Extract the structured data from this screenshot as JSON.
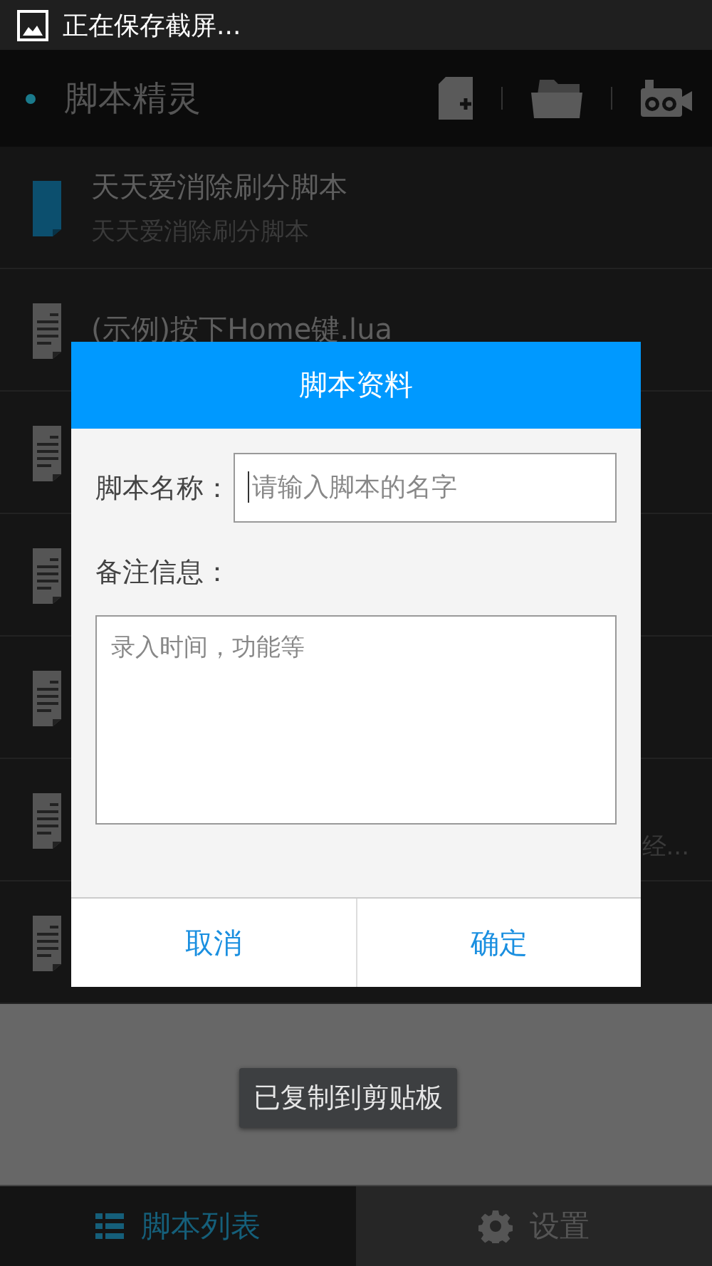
{
  "status_bar": {
    "notification": "正在保存截屏..."
  },
  "app_bar": {
    "title": "脚本精灵"
  },
  "scripts": [
    {
      "kind": "project",
      "title": "天天爱消除刷分脚本",
      "subtitle": "天天爱消除刷分脚本"
    },
    {
      "kind": "file",
      "title": "(示例)按下Home键.lua"
    },
    {
      "kind": "file"
    },
    {
      "kind": "file"
    },
    {
      "kind": "file"
    },
    {
      "kind": "file",
      "subtitle": "经..."
    },
    {
      "kind": "file"
    }
  ],
  "dialog": {
    "title": "脚本资料",
    "name_label": "脚本名称：",
    "name_placeholder": "请输入脚本的名字",
    "notes_label": "备注信息：",
    "notes_placeholder": "录入时间，功能等",
    "buttons": [
      "取消",
      "确定"
    ]
  },
  "toast": "已复制到剪贴板",
  "tabs": [
    {
      "kind": "list",
      "label": "脚本列表",
      "selected": true
    },
    {
      "kind": "settings",
      "label": "设置",
      "selected": false
    }
  ]
}
